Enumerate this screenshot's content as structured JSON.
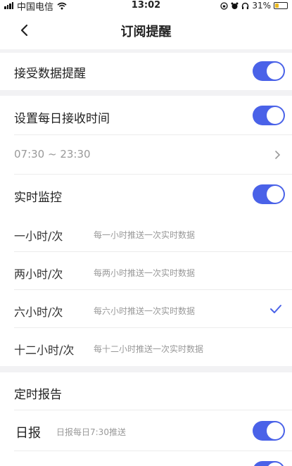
{
  "status_bar": {
    "carrier": "中国电信",
    "time": "13:02",
    "battery": "31%"
  },
  "nav": {
    "title": "订阅提醒",
    "back_icon": "chevron-left-icon"
  },
  "settings": {
    "receive_data_alerts": {
      "label": "接受数据提醒",
      "enabled": true
    },
    "daily_receive_time": {
      "label": "设置每日接收时间",
      "enabled": true,
      "range": "07:30 ~ 23:30"
    },
    "realtime_monitor": {
      "label": "实时监控",
      "enabled": true
    },
    "frequency_options": [
      {
        "label": "一小时/次",
        "desc": "每一小时推送一次实时数据",
        "selected": false
      },
      {
        "label": "两小时/次",
        "desc": "每两小时推送一次实时数据",
        "selected": false
      },
      {
        "label": "六小时/次",
        "desc": "每六小时推送一次实时数据",
        "selected": true
      },
      {
        "label": "十二小时/次",
        "desc": "每十二小时推送一次实时数据",
        "selected": false
      }
    ],
    "scheduled_report": {
      "label": "定时报告"
    },
    "daily_report": {
      "label": "日报",
      "desc": "日报每日7:30推送",
      "enabled": true
    }
  },
  "colors": {
    "accent": "#4a62e8",
    "background": "#f2f2f4"
  }
}
